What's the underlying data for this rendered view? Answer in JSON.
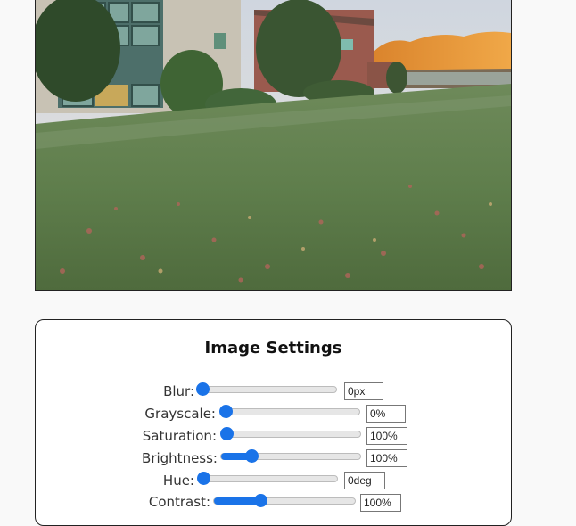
{
  "photo": {
    "description_icon": "landscape-photo"
  },
  "panel": {
    "title": "Image Settings"
  },
  "controls": [
    {
      "label": "Blur:",
      "value": "0px",
      "level": 0
    },
    {
      "label": "Grayscale:",
      "value": "0%",
      "level": 0
    },
    {
      "label": "Saturation:",
      "value": "100%",
      "level": 0
    },
    {
      "label": "Brightness:",
      "value": "100%",
      "level": 0.22
    },
    {
      "label": "Hue:",
      "value": "0deg",
      "level": 0
    },
    {
      "label": "Contrast:",
      "value": "100%",
      "level": 0.33
    }
  ],
  "accent_color": "#1a73e8"
}
